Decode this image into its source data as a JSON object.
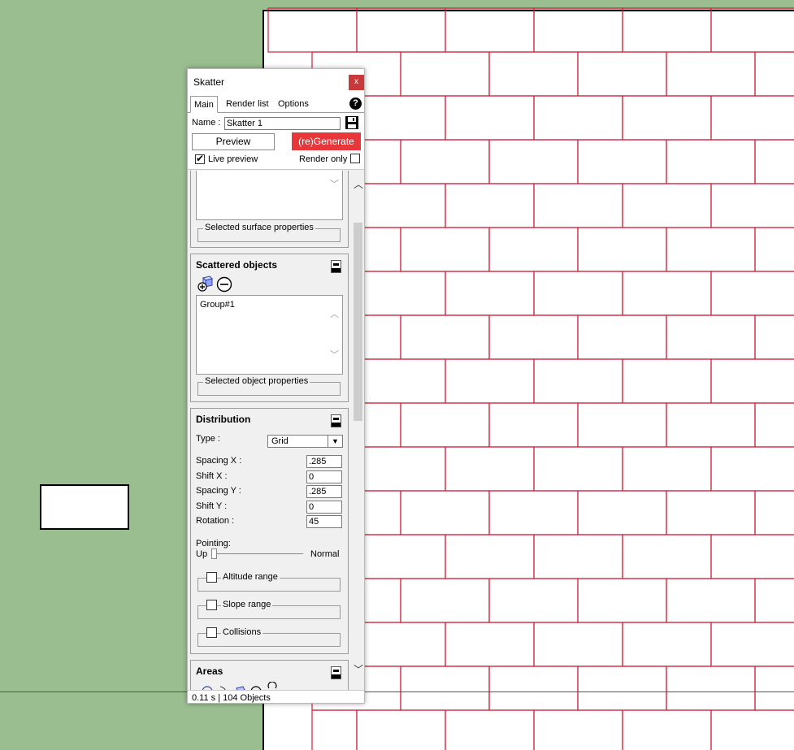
{
  "colors": {
    "background_green": "#9bbe91",
    "brick_line": "#d0203c",
    "generate_button": "#e8373b",
    "close_button": "#c9383a"
  },
  "window": {
    "title": "Skatter",
    "close_label": "x",
    "tabs": [
      "Main",
      "Render list",
      "Options"
    ],
    "help_label": "?"
  },
  "header": {
    "name_label": "Name :",
    "name_value": "Skatter 1",
    "preview_label": "Preview",
    "generate_label": "(re)Generate",
    "live_preview_label": "Live preview",
    "live_preview_checked": true,
    "render_only_label": "Render only",
    "render_only_checked": false
  },
  "surfaces": {
    "selected_surface_properties": "Selected surface properties"
  },
  "scattered_objects": {
    "title": "Scattered objects",
    "items": [
      "Group#1"
    ],
    "selected_object_properties": "Selected object properties"
  },
  "distribution": {
    "title": "Distribution",
    "type_label": "Type :",
    "type_value": "Grid",
    "spacing_x_label": "Spacing X :",
    "spacing_x_value": ".285",
    "shift_x_label": "Shift X :",
    "shift_x_value": "0",
    "spacing_y_label": "Spacing Y :",
    "spacing_y_value": ".285",
    "shift_y_label": "Shift Y :",
    "shift_y_value": "0",
    "rotation_label": "Rotation :",
    "rotation_value": "45",
    "pointing_label": "Pointing:",
    "pointing_min": "Up",
    "pointing_max": "Normal",
    "pointing_level": 0,
    "altitude_label": "Altitude range",
    "slope_label": "Slope range",
    "collisions_label": "Collisions"
  },
  "areas": {
    "title": "Areas"
  },
  "status": {
    "text": "0.11 s | 104 Objects"
  },
  "icons": [
    "save-icon",
    "help-icon",
    "add-object-icon",
    "remove-icon",
    "collapse-icon",
    "scroll-up-icon",
    "scroll-down-icon",
    "checkmark-icon"
  ]
}
